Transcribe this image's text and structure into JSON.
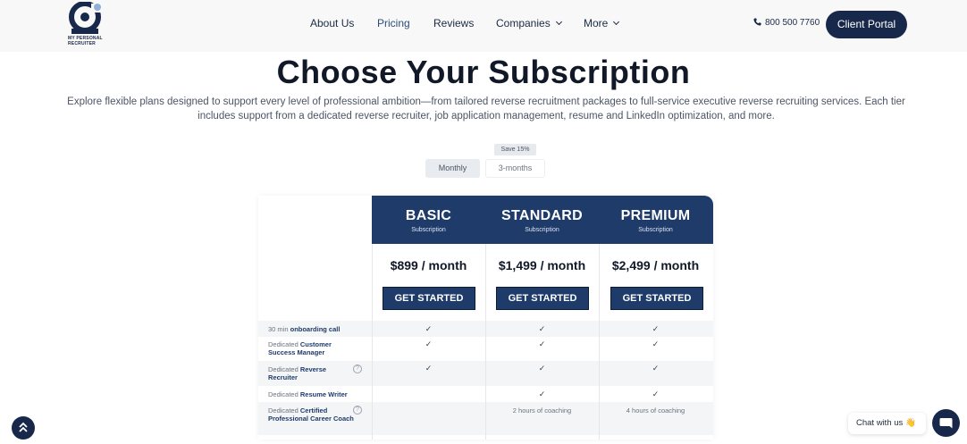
{
  "brand": {
    "logo_text": "MY PERSONAL\nRECRUITER",
    "primary_color": "#17284a",
    "accent_color": "#1e3b6a"
  },
  "nav": {
    "items": [
      {
        "label": "About Us",
        "dropdown": false,
        "active": false
      },
      {
        "label": "Pricing",
        "dropdown": false,
        "active": true
      },
      {
        "label": "Reviews",
        "dropdown": false,
        "active": false
      },
      {
        "label": "Companies",
        "dropdown": true,
        "active": false
      },
      {
        "label": "More",
        "dropdown": true,
        "active": false
      }
    ],
    "phone": "800 500 7760",
    "portal_label": "Client Portal"
  },
  "hero": {
    "title": "Choose Your Subscription",
    "subtitle": "Explore flexible plans designed to support every level of professional ambition—from tailored reverse recruitment packages to full-service executive reverse recruiting services. Each tier includes support from a dedicated reverse recruiter, job application management, resume and LinkedIn optimization, and more."
  },
  "billing": {
    "save_badge": "Save 15%",
    "monthly_label": "Monthly",
    "quarterly_label": "3-months",
    "selected": "Monthly"
  },
  "plans": [
    {
      "name": "BASIC",
      "sub": "Subscription",
      "price": "$899 / month",
      "cta": "GET STARTED"
    },
    {
      "name": "STANDARD",
      "sub": "Subscription",
      "price": "$1,499 / month",
      "cta": "GET STARTED"
    },
    {
      "name": "PREMIUM",
      "sub": "Subscription",
      "price": "$2,499 / month",
      "cta": "GET STARTED"
    }
  ],
  "features": [
    {
      "prefix": "30 min ",
      "bold": "onboarding call",
      "help": false,
      "cells": [
        "✓",
        "✓",
        "✓"
      ]
    },
    {
      "prefix": "Dedicated ",
      "bold": "Customer Success Manager",
      "help": false,
      "cells": [
        "✓",
        "✓",
        "✓"
      ]
    },
    {
      "prefix": "Dedicated ",
      "bold": "Reverse Recruiter",
      "help": true,
      "cells": [
        "✓",
        "✓",
        "✓"
      ]
    },
    {
      "prefix": "Dedicated ",
      "bold": "Resume Writer",
      "help": false,
      "cells": [
        "",
        "✓",
        "✓"
      ]
    },
    {
      "prefix": "Dedicated ",
      "bold": "Certified Professional Career Coach",
      "help": true,
      "cells": [
        "",
        "2 hours of coaching",
        "4 hours of coaching"
      ]
    }
  ],
  "chat": {
    "label": "Chat with us",
    "emoji": "👋"
  }
}
